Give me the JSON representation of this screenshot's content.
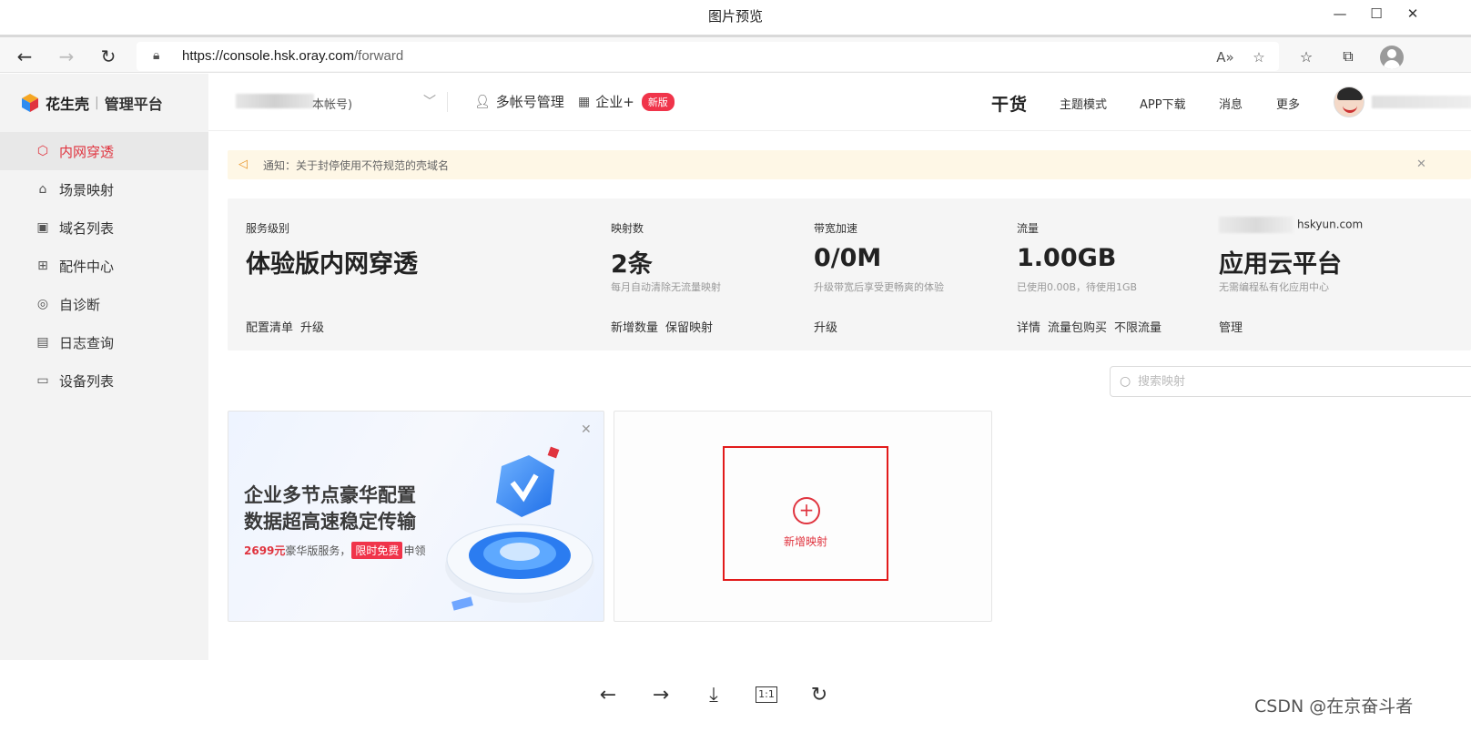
{
  "viewer": {
    "title": "图片预览",
    "window_controls": {
      "minimize": "—",
      "maximize": "☐",
      "close": "✕"
    },
    "bottom_tools": [
      "←",
      "→",
      "⤓",
      "1:1",
      "↻"
    ],
    "watermark": "CSDN @在京奋斗者"
  },
  "browser": {
    "url_host": "https://console.hsk.oray.com",
    "url_path": "/forward",
    "read_aloud_icon": "A»"
  },
  "app": {
    "logo": {
      "brand": "花生壳",
      "sep": "|",
      "sub": "管理平台"
    },
    "sidebar": {
      "items": [
        {
          "label": "内网穿透",
          "icon": "⬡",
          "active": true
        },
        {
          "label": "场景映射",
          "icon": "⌂",
          "active": false
        },
        {
          "label": "域名列表",
          "icon": "▣",
          "active": false
        },
        {
          "label": "配件中心",
          "icon": "⊞",
          "active": false
        },
        {
          "label": "自诊断",
          "icon": "◎",
          "active": false
        },
        {
          "label": "日志查询",
          "icon": "▤",
          "active": false
        },
        {
          "label": "设备列表",
          "icon": "▭",
          "active": false
        }
      ]
    },
    "header": {
      "account_suffix": "本帐号)",
      "multi_account": "多帐号管理",
      "enterprise": "企业+",
      "new_badge": "新版",
      "ganhuo": "干货",
      "menu": [
        "主题模式",
        "APP下载",
        "消息",
        "更多"
      ]
    },
    "notice": {
      "text": "通知：关于封停使用不符规范的壳域名"
    },
    "stats": [
      {
        "label": "服务级别",
        "value": "体验版内网穿透",
        "sub": "",
        "links": [
          "配置清单",
          "升级"
        ]
      },
      {
        "label": "映射数",
        "value": "2条",
        "sub": "每月自动清除无流量映射",
        "links": [
          "新增数量",
          "保留映射"
        ]
      },
      {
        "label": "带宽加速",
        "value": "0/0M",
        "sub": "升级带宽后享受更畅爽的体验",
        "links": [
          "升级"
        ]
      },
      {
        "label": "流量",
        "value": "1.00GB",
        "sub": "已使用0.00B，待使用1GB",
        "links": [
          "详情",
          "流量包购买",
          "不限流量"
        ]
      },
      {
        "label": "hskyun.com",
        "value": "应用云平台",
        "sub": "无需编程私有化应用中心",
        "links": [
          "管理"
        ]
      }
    ],
    "search": {
      "placeholder": "搜索映射"
    },
    "promo": {
      "line1": "企业多节点豪华配置",
      "line2": "数据超高速稳定传输",
      "price": "2699元",
      "service": "豪华版服务，",
      "free": "限时免费",
      "claim": "申领"
    },
    "add_mapping": {
      "label": "新增映射",
      "plus": "+"
    }
  },
  "colors": {
    "accent": "#e0343f",
    "highlight_border": "#e21b1b",
    "notice_bg": "#fef7e6",
    "stats_bg": "#f5f5f5",
    "sidebar_bg": "#f3f3f3"
  }
}
